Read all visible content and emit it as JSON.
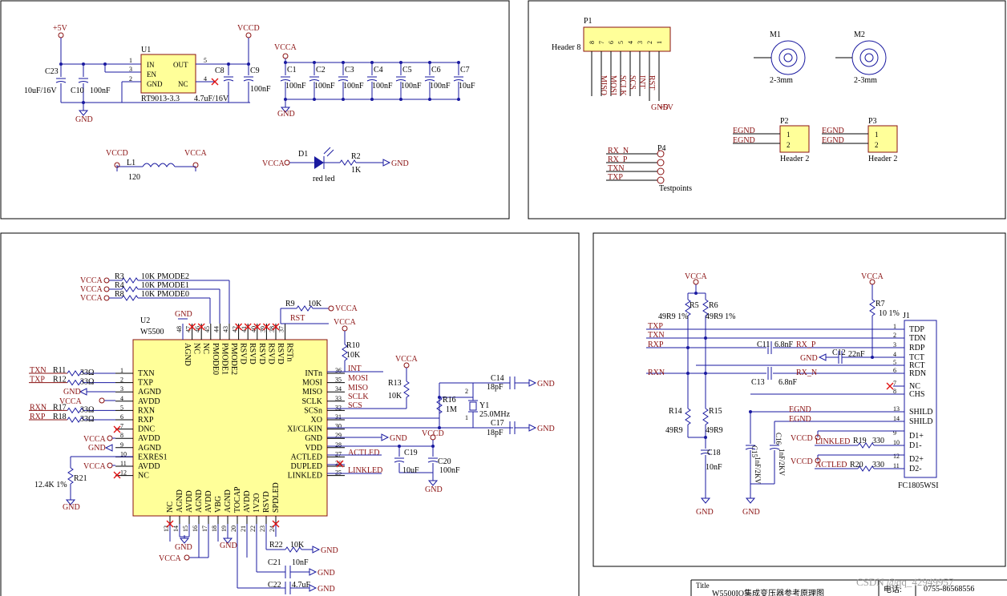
{
  "top_left": {
    "v5": "+5V",
    "vccd": "VCCD",
    "vcca": "VCCA",
    "gnd": "GND",
    "u1": {
      "ref": "U1",
      "part": "RT9013-3.3",
      "pins": [
        "IN",
        "EN",
        "GND",
        "OUT",
        "NC"
      ],
      "pin_nums": [
        "1",
        "3",
        "2",
        "5",
        "4"
      ]
    },
    "c23": {
      "ref": "C23",
      "value": "10uF/16V"
    },
    "c10": {
      "ref": "C10",
      "value": "100nF"
    },
    "c8": {
      "ref": "C8",
      "value": "4.7uF/16V"
    },
    "c9": {
      "ref": "C9",
      "value": "100nF"
    },
    "caps": [
      {
        "ref": "C1",
        "value": "100nF"
      },
      {
        "ref": "C2",
        "value": "100nF"
      },
      {
        "ref": "C3",
        "value": "100nF"
      },
      {
        "ref": "C4",
        "value": "100nF"
      },
      {
        "ref": "C5",
        "value": "100nF"
      },
      {
        "ref": "C6",
        "value": "100nF"
      },
      {
        "ref": "C7",
        "value": "10uF"
      }
    ],
    "l1": {
      "ref": "L1",
      "value": "120"
    },
    "d1": {
      "ref": "D1",
      "value": "red led"
    },
    "r2": {
      "ref": "R2",
      "value": "1K"
    }
  },
  "top_right": {
    "p1": {
      "ref": "P1",
      "name": "Header 8",
      "pins": [
        "8",
        "7",
        "6",
        "5",
        "4",
        "3",
        "2",
        "1"
      ],
      "signals": [
        "MISO",
        "MOSI",
        "SCLK",
        "SCS",
        "INT",
        "RST"
      ],
      "gnd": "GND",
      "v5": "+5V"
    },
    "m1": {
      "ref": "M1",
      "value": "2-3mm"
    },
    "m2": {
      "ref": "M2",
      "value": "2-3mm"
    },
    "p2": {
      "ref": "P2",
      "name": "Header 2",
      "nets": [
        "EGND",
        "EGND"
      ],
      "pins": [
        "1",
        "2"
      ]
    },
    "p3": {
      "ref": "P3",
      "name": "Header 2",
      "nets": [
        "EGND",
        "EGND"
      ],
      "pins": [
        "1",
        "2"
      ]
    },
    "p4": {
      "ref": "P4",
      "name": "Testpoints",
      "nets": [
        "RX_N",
        "RX_P",
        "TXN",
        "TXP"
      ]
    }
  },
  "bottom_left": {
    "u2": {
      "ref": "U2",
      "part": "W5500"
    },
    "left_pins": [
      {
        "num": "1",
        "name": "TXN"
      },
      {
        "num": "2",
        "name": "TXP"
      },
      {
        "num": "3",
        "name": "AGND"
      },
      {
        "num": "4",
        "name": "AVDD"
      },
      {
        "num": "5",
        "name": "RXN"
      },
      {
        "num": "6",
        "name": "RXP"
      },
      {
        "num": "7",
        "name": "DNC"
      },
      {
        "num": "8",
        "name": "AVDD"
      },
      {
        "num": "9",
        "name": "AGND"
      },
      {
        "num": "10",
        "name": "EXRES1"
      },
      {
        "num": "11",
        "name": "AVDD"
      },
      {
        "num": "12",
        "name": "NC"
      }
    ],
    "right_pins": [
      {
        "num": "36",
        "name": "INTn"
      },
      {
        "num": "35",
        "name": "MOSI"
      },
      {
        "num": "34",
        "name": "MISO"
      },
      {
        "num": "33",
        "name": "SCLK"
      },
      {
        "num": "32",
        "name": "SCSn"
      },
      {
        "num": "31",
        "name": "XO"
      },
      {
        "num": "30",
        "name": "XI/CLKIN"
      },
      {
        "num": "29",
        "name": "GND"
      },
      {
        "num": "28",
        "name": "VDD"
      },
      {
        "num": "27",
        "name": "ACTLED"
      },
      {
        "num": "26",
        "name": "DUPLED"
      },
      {
        "num": "25",
        "name": "LINKLED"
      }
    ],
    "top_pins": [
      {
        "num": "48",
        "name": "AGND"
      },
      {
        "num": "47",
        "name": "NC"
      },
      {
        "num": "46",
        "name": "NC"
      },
      {
        "num": "45",
        "name": "PMODE0"
      },
      {
        "num": "44",
        "name": "PMODE1"
      },
      {
        "num": "43",
        "name": "PMODE2"
      },
      {
        "num": "42",
        "name": "RSVD"
      },
      {
        "num": "41",
        "name": "RSVD"
      },
      {
        "num": "40",
        "name": "RSVD"
      },
      {
        "num": "39",
        "name": "RSVD"
      },
      {
        "num": "38",
        "name": "RSVD"
      },
      {
        "num": "37",
        "name": "RSTn"
      }
    ],
    "bottom_pins": [
      {
        "num": "13",
        "name": "NC"
      },
      {
        "num": "14",
        "name": "AGND"
      },
      {
        "num": "15",
        "name": "AVDD"
      },
      {
        "num": "16",
        "name": "AGND"
      },
      {
        "num": "17",
        "name": "AVDD"
      },
      {
        "num": "18",
        "name": "VBG"
      },
      {
        "num": "19",
        "name": "AGND"
      },
      {
        "num": "20",
        "name": "TOCAP"
      },
      {
        "num": "21",
        "name": "AVDD"
      },
      {
        "num": "22",
        "name": "1V2O"
      },
      {
        "num": "23",
        "name": "RSVD"
      },
      {
        "num": "24",
        "name": "SPDLED"
      }
    ],
    "r3": {
      "ref": "R3",
      "value": "10K",
      "net": "PMODE2"
    },
    "r4": {
      "ref": "R4",
      "value": "10K",
      "net": "PMODE1"
    },
    "r8": {
      "ref": "R8",
      "value": "10K",
      "net": "PMODE0"
    },
    "r9": {
      "ref": "R9",
      "value": "10K"
    },
    "r10": {
      "ref": "R10",
      "value": "10K"
    },
    "r11": {
      "ref": "R11",
      "value": "33Ω",
      "net": "TXN"
    },
    "r12": {
      "ref": "R12",
      "value": "33Ω",
      "net": "TXP"
    },
    "r17": {
      "ref": "R17",
      "value": "33Ω",
      "net": "RXN"
    },
    "r18": {
      "ref": "R18",
      "value": "33Ω",
      "net": "RXP"
    },
    "r13": {
      "ref": "R13",
      "value": "10K"
    },
    "r16": {
      "ref": "R16",
      "value": "1M"
    },
    "r21": {
      "ref": "R21",
      "value": "12.4K 1%"
    },
    "r22": {
      "ref": "R22",
      "value": "10K"
    },
    "y1": {
      "ref": "Y1",
      "value": "25.0MHz"
    },
    "c14": {
      "ref": "C14",
      "value": "18pF"
    },
    "c17": {
      "ref": "C17",
      "value": "18pF"
    },
    "c19": {
      "ref": "C19",
      "value": "10uF"
    },
    "c20": {
      "ref": "C20",
      "value": "100nF"
    },
    "c21": {
      "ref": "C21",
      "value": "10nF"
    },
    "c22": {
      "ref": "C22",
      "value": "4.7uF"
    },
    "nets": {
      "rst": "RST",
      "int": "INT",
      "mosi": "MOSI",
      "miso": "MISO",
      "sclk": "SCLK",
      "scs": "SCS",
      "actled": "ACTLED",
      "linkled": "LINKLED"
    }
  },
  "bottom_right": {
    "j1": {
      "ref": "J1",
      "part": "FC1805WSI",
      "pins": [
        {
          "num": "1",
          "name": "TDP"
        },
        {
          "num": "2",
          "name": "TDN"
        },
        {
          "num": "3",
          "name": "RDP"
        },
        {
          "num": "4",
          "name": "TCT"
        },
        {
          "num": "5",
          "name": "RCT"
        },
        {
          "num": "6",
          "name": "RDN"
        },
        {
          "num": "7",
          "name": "NC"
        },
        {
          "num": "8",
          "name": "CHS"
        },
        {
          "num": "13",
          "name": "SHILD"
        },
        {
          "num": "14",
          "name": "SHILD"
        },
        {
          "num": "9",
          "name": "D1+"
        },
        {
          "num": "10",
          "name": "D1-"
        },
        {
          "num": "12",
          "name": "D2+"
        },
        {
          "num": "11",
          "name": "D2-"
        }
      ]
    },
    "r5": {
      "ref": "R5",
      "value": "49R9 1%"
    },
    "r6": {
      "ref": "R6",
      "value": "49R9 1%"
    },
    "r7": {
      "ref": "R7",
      "value": "10 1%"
    },
    "r14": {
      "ref": "R14",
      "value": "49R9"
    },
    "r15": {
      "ref": "R15",
      "value": "49R9"
    },
    "r19": {
      "ref": "R19",
      "value": "330"
    },
    "r20": {
      "ref": "R20",
      "value": "330"
    },
    "c11": {
      "ref": "C11",
      "value": "6.8nF"
    },
    "c12": {
      "ref": "C12",
      "value": "22nF"
    },
    "c13": {
      "ref": "C13",
      "value": "6.8nF"
    },
    "c15": {
      "ref": "C15",
      "value": "1nF/2KV"
    },
    "c16": {
      "ref": "C16",
      "value": "1nF/2KV"
    },
    "c18": {
      "ref": "C18",
      "value": "10nF"
    },
    "nets": [
      "TXP",
      "TXN",
      "RXP",
      "RXN",
      "RX_P",
      "RX_N",
      "EGND",
      "EGND",
      "LINKLED",
      "ACTLED"
    ]
  },
  "title_block": {
    "title_label": "Title",
    "title": "W5500IO集成变压器参考原理图",
    "phone_label": "电话:",
    "phone": "0755-86568556"
  },
  "watermark": "CSDN @qq_42949957"
}
